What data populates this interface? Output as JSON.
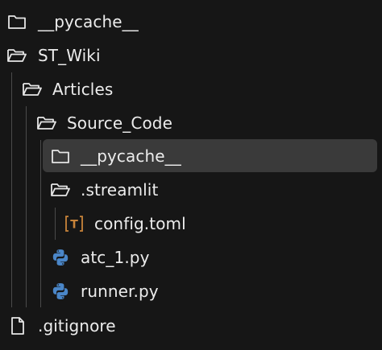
{
  "tree": {
    "items": [
      {
        "label": "__pycache__",
        "icon": "folder-closed-icon"
      },
      {
        "label": "ST_Wiki",
        "icon": "folder-open-icon"
      },
      {
        "label": "Articles",
        "icon": "folder-open-icon"
      },
      {
        "label": "Source_Code",
        "icon": "folder-open-icon"
      },
      {
        "label": "__pycache__",
        "icon": "folder-closed-icon",
        "selected": true
      },
      {
        "label": ".streamlit",
        "icon": "folder-open-icon"
      },
      {
        "label": "config.toml",
        "icon": "toml-file-icon",
        "icon_text": "T"
      },
      {
        "label": "atc_1.py",
        "icon": "python-file-icon"
      },
      {
        "label": "runner.py",
        "icon": "python-file-icon"
      },
      {
        "label": ".gitignore",
        "icon": "file-icon"
      }
    ]
  },
  "colors": {
    "background": "#161616",
    "selected_row": "#3a3a3a",
    "guide_line": "#4a4a4a",
    "toml_icon": "#c8843a",
    "python_blue": "#4a86c8",
    "python_yellow": "#ffd43b"
  }
}
